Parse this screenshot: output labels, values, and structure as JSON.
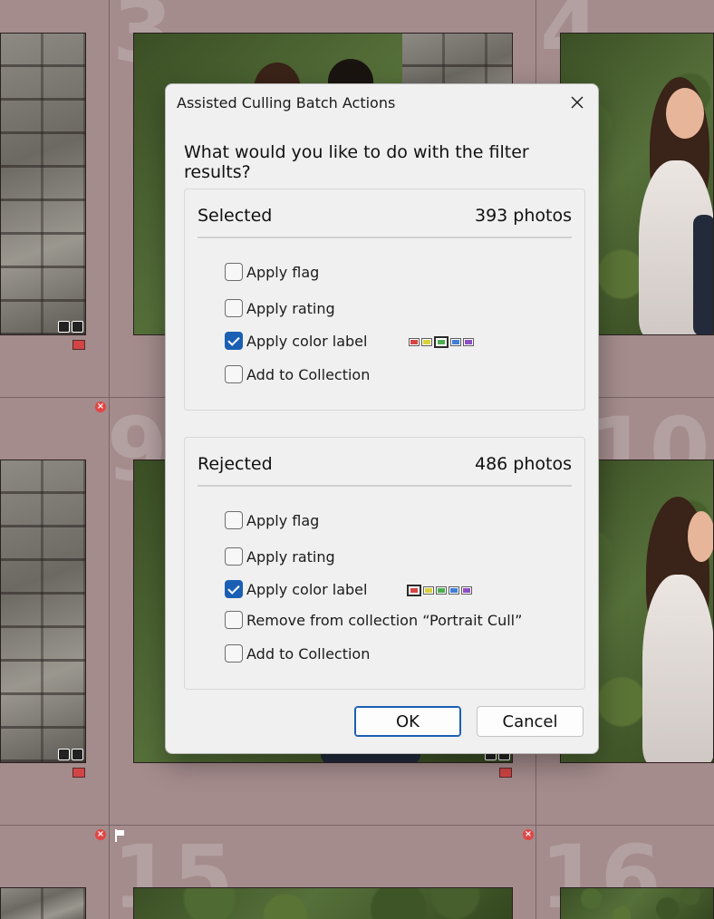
{
  "dialog": {
    "title": "Assisted Culling Batch Actions",
    "question": "What would you like to do with the filter results?",
    "selected": {
      "heading": "Selected",
      "count": "393 photos",
      "options": [
        {
          "label": "Apply flag",
          "checked": false
        },
        {
          "label": "Apply rating",
          "checked": false
        },
        {
          "label": "Apply color label",
          "checked": true
        },
        {
          "label": "Add to Collection",
          "checked": false
        }
      ],
      "selected_color_index": 2
    },
    "rejected": {
      "heading": "Rejected",
      "count": "486 photos",
      "options": [
        {
          "label": "Apply flag",
          "checked": false
        },
        {
          "label": "Apply rating",
          "checked": false
        },
        {
          "label": "Apply color label",
          "checked": true
        },
        {
          "label": "Remove from collection “Portrait Cull”",
          "checked": false
        },
        {
          "label": "Add to Collection",
          "checked": false
        }
      ],
      "selected_color_index": 0
    },
    "ok_label": "OK",
    "cancel_label": "Cancel"
  },
  "color_labels": [
    "#d64545",
    "#d9d23a",
    "#4caf50",
    "#3f7fd8",
    "#8e4fc6"
  ],
  "background": {
    "cell_numbers": [
      "3",
      "4",
      "9",
      "10",
      "15",
      "16"
    ]
  },
  "colors": {
    "accent": "#1a5fb4",
    "dialog_bg": "#f0f0f0",
    "grid_bg": "#a48b8c",
    "reject_badge": "#e24545"
  }
}
